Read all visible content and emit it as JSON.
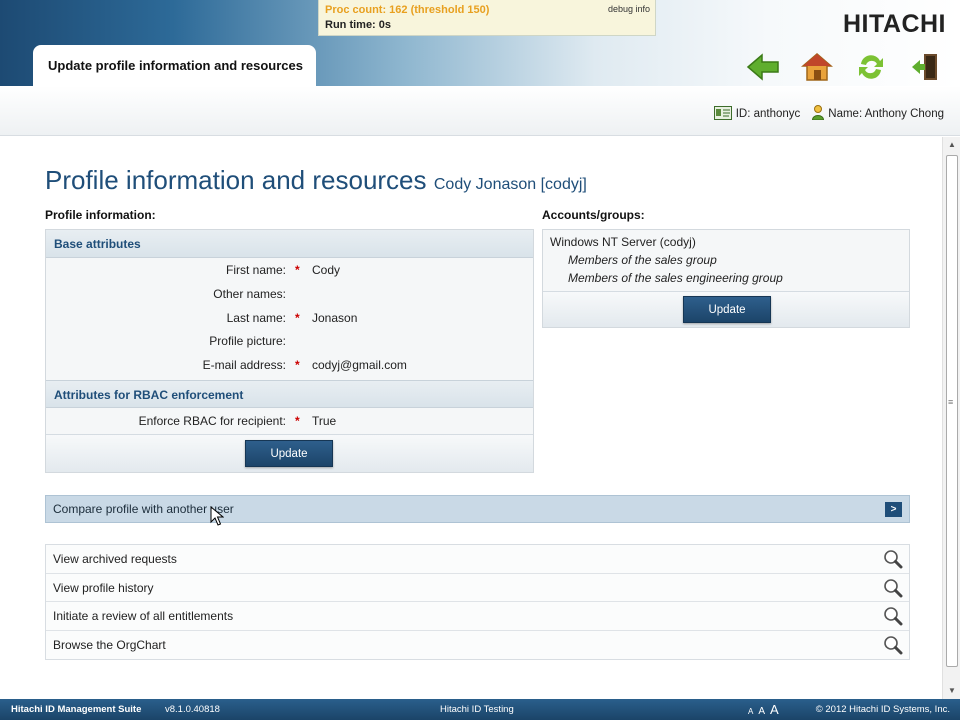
{
  "debug": {
    "proc_count": "Proc count: 162 (threshold 150)",
    "run_time": "Run time: 0s",
    "debug_info": "debug info"
  },
  "brand": {
    "logo": "HITACHI"
  },
  "tab": {
    "label": "Update profile information and resources"
  },
  "toolbar_icons": [
    "back-arrow-icon",
    "home-icon",
    "refresh-icon",
    "logout-door-icon"
  ],
  "user": {
    "id": "ID: anthonyc",
    "name": "Name: Anthony Chong"
  },
  "page": {
    "title": "Profile information and resources",
    "subtitle": "Cody Jonason [codyj]"
  },
  "profile": {
    "label": "Profile information:",
    "base_heading": "Base attributes",
    "fields": [
      {
        "label": "First name:",
        "required": true,
        "value": "Cody"
      },
      {
        "label": "Other names:",
        "required": false,
        "value": ""
      },
      {
        "label": "Last name:",
        "required": true,
        "value": "Jonason"
      },
      {
        "label": "Profile picture:",
        "required": false,
        "value": ""
      },
      {
        "label": "E-mail address:",
        "required": true,
        "value": "codyj@gmail.com"
      }
    ],
    "rbac_heading": "Attributes for RBAC enforcement",
    "rbac_field": {
      "label": "Enforce RBAC for recipient:",
      "required": true,
      "value": "True"
    },
    "required_mark": "*",
    "update_label": "Update"
  },
  "accounts": {
    "label": "Accounts/groups:",
    "system": "Windows NT Server (codyj)",
    "groups": [
      "Members of the sales group",
      "Members of the sales engineering group"
    ],
    "update_label": "Update"
  },
  "compare": {
    "label": "Compare profile with another user",
    "go": ">"
  },
  "links": [
    {
      "label": "View archived requests"
    },
    {
      "label": "View profile history"
    },
    {
      "label": "Initiate a review of all entitlements"
    },
    {
      "label": "Browse the OrgChart"
    }
  ],
  "footer": {
    "product": "Hitachi ID Management Suite",
    "version": "v8.1.0.40818",
    "instance": "Hitachi ID Testing",
    "font_sizes": [
      "A",
      "A",
      "A"
    ],
    "copyright": "© 2012 Hitachi ID Systems, Inc."
  },
  "colors": {
    "title": "#1f4e79",
    "button": "#1c4469",
    "required": "#cc0000",
    "proc_count": "#e8a020"
  }
}
